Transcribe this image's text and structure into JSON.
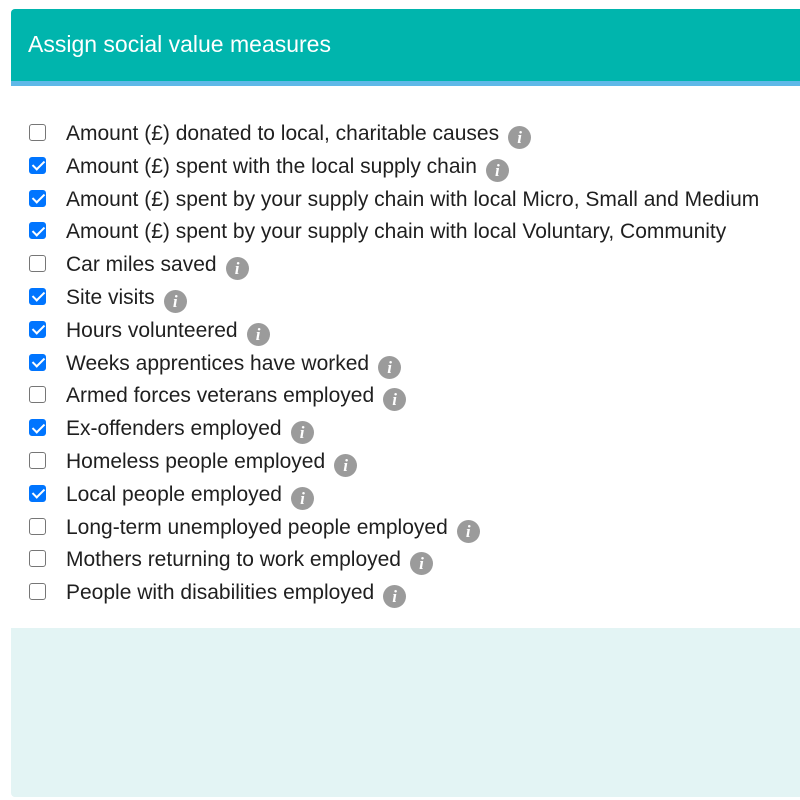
{
  "panel": {
    "title": "Assign social value measures",
    "header_color": "#00b5ad",
    "header_border_color": "#5fb8e8",
    "footer_background": "#e3f4f4"
  },
  "checkbox_accent": "#0075ff",
  "info_icon": {
    "name": "info-icon",
    "glyph": "i",
    "color": "#9b9b9b"
  },
  "measures": [
    {
      "label": "Amount (£) donated to local, charitable causes",
      "checked": false,
      "has_info": true
    },
    {
      "label": "Amount (£) spent with the local supply chain",
      "checked": true,
      "has_info": true
    },
    {
      "label": "Amount (£) spent by your supply chain with local Micro, Small and Medium",
      "checked": true,
      "has_info": false
    },
    {
      "label": "Amount (£) spent by your supply chain with local Voluntary, Community",
      "checked": true,
      "has_info": false
    },
    {
      "label": "Car miles saved",
      "checked": false,
      "has_info": true
    },
    {
      "label": "Site visits",
      "checked": true,
      "has_info": true
    },
    {
      "label": "Hours volunteered",
      "checked": true,
      "has_info": true
    },
    {
      "label": "Weeks apprentices have worked",
      "checked": true,
      "has_info": true
    },
    {
      "label": "Armed forces veterans employed",
      "checked": false,
      "has_info": true
    },
    {
      "label": "Ex-offenders employed",
      "checked": true,
      "has_info": true
    },
    {
      "label": "Homeless people employed",
      "checked": false,
      "has_info": true
    },
    {
      "label": "Local people employed",
      "checked": true,
      "has_info": true
    },
    {
      "label": "Long-term unemployed people employed",
      "checked": false,
      "has_info": true
    },
    {
      "label": "Mothers returning to work employed",
      "checked": false,
      "has_info": true
    },
    {
      "label": "People with disabilities employed",
      "checked": false,
      "has_info": true
    }
  ]
}
